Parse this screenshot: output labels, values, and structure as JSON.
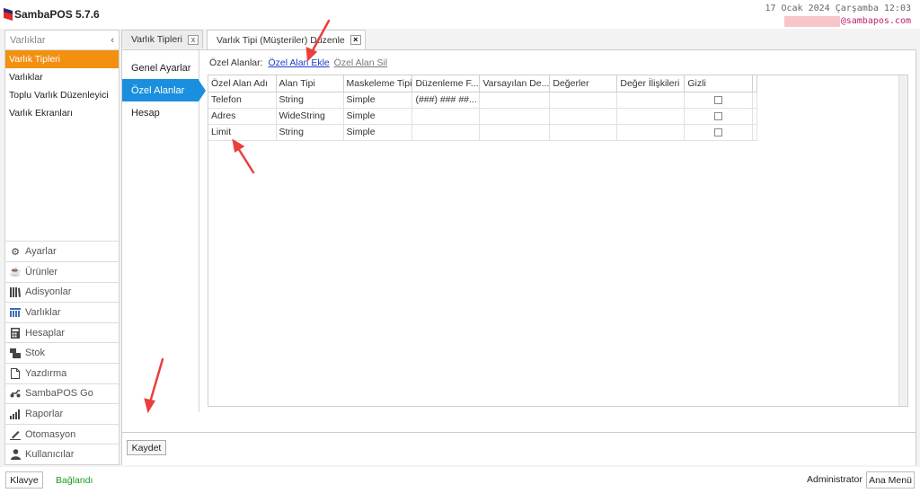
{
  "app": {
    "title": "SambaPOS 5.7.6",
    "datetime": "17 Ocak 2024 Çarşamba 12:03",
    "email_domain": "@sambapos.com",
    "logo_color": "#e02a2a"
  },
  "sidebar": {
    "header": "Varlıklar",
    "items": [
      {
        "label": "Varlık Tipleri",
        "active": true
      },
      {
        "label": "Varlıklar"
      },
      {
        "label": "Toplu Varlık Düzenleyici"
      },
      {
        "label": "Varlık Ekranları"
      }
    ],
    "nav": [
      {
        "label": "Ayarlar",
        "icon": "gear-icon"
      },
      {
        "label": "Ürünler",
        "icon": "coffee-icon"
      },
      {
        "label": "Adisyonlar",
        "icon": "books-icon"
      },
      {
        "label": "Varlıklar",
        "icon": "table-icon"
      },
      {
        "label": "Hesaplar",
        "icon": "calculator-icon"
      },
      {
        "label": "Stok",
        "icon": "stock-icon"
      },
      {
        "label": "Yazdırma",
        "icon": "document-icon"
      },
      {
        "label": "SambaPOS Go",
        "icon": "scooter-icon"
      },
      {
        "label": "Raporlar",
        "icon": "bar-chart-icon"
      },
      {
        "label": "Otomasyon",
        "icon": "pen-icon"
      },
      {
        "label": "Kullanıcılar",
        "icon": "user-icon"
      }
    ]
  },
  "tabs": [
    {
      "label": "Varlık Tipleri",
      "close": "x"
    },
    {
      "label": "Varlık Tipi (Müşteriler) Düzenle",
      "close": "×",
      "active": true
    }
  ],
  "subnav": [
    {
      "label": "Genel Ayarlar"
    },
    {
      "label": "Özel Alanlar",
      "active": true
    },
    {
      "label": "Hesap"
    }
  ],
  "panel": {
    "label": "Özel Alanlar:",
    "add_link": "Özel Alan Ekle",
    "delete_link": "Özel Alan Sil"
  },
  "grid": {
    "columns": [
      "Özel Alan Adı",
      "Alan Tipi",
      "Maskeleme Tipi",
      "Düzenleme F...",
      "Varsayılan De...",
      "Değerler",
      "Değer İlişkileri",
      "Gizli"
    ],
    "rows": [
      [
        "Telefon",
        "String",
        "Simple",
        "(###) ### ##...",
        "",
        "",
        "",
        ""
      ],
      [
        "Adres",
        "WideString",
        "Simple",
        "",
        "",
        "",
        "",
        ""
      ],
      [
        "Limit",
        "String",
        "Simple",
        "",
        "",
        "",
        "",
        ""
      ]
    ]
  },
  "footer": {
    "save_label": "Kaydet"
  },
  "statusbar": {
    "keyboard_label": "Klavye",
    "connection_status": "Bağlandı",
    "user": "Administrator",
    "main_menu_label": "Ana Menü",
    "connection_color": "#1c9a1c"
  },
  "accent": {
    "orange": "#f29010",
    "blue": "#1a8fdd",
    "arrow_red": "#e8413c"
  }
}
